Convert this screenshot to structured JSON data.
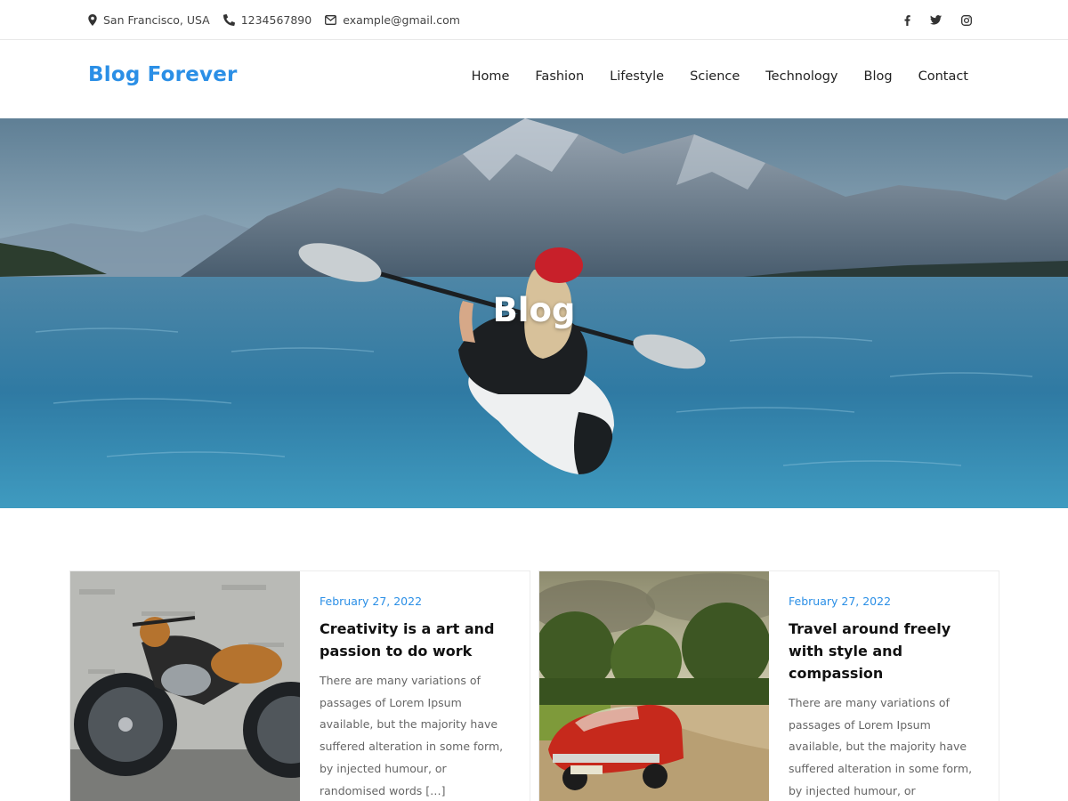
{
  "topbar": {
    "location": "San Francisco, USA",
    "phone": "1234567890",
    "email": "example@gmail.com",
    "social_icons": [
      "facebook-icon",
      "twitter-icon",
      "instagram-icon"
    ]
  },
  "header": {
    "logo": "Blog Forever",
    "nav": [
      "Home",
      "Fashion",
      "Lifestyle",
      "Science",
      "Technology",
      "Blog",
      "Contact"
    ]
  },
  "hero": {
    "title": "Blog"
  },
  "posts": [
    {
      "date": "February 27, 2022",
      "title": "Creativity is a art and passion to do work",
      "excerpt": "There are many variations of passages of Lorem Ipsum available, but the majority have suffered alteration in some form, by injected humour, or randomised words […]"
    },
    {
      "date": "February 27, 2022",
      "title": "Travel around freely with style and compassion",
      "excerpt": "There are many variations of passages of Lorem Ipsum available, but the majority have suffered alteration in some form, by injected humour, or randomised words […]"
    }
  ],
  "colors": {
    "accent": "#2b8fe6",
    "text": "#222222",
    "muted": "#666666"
  }
}
